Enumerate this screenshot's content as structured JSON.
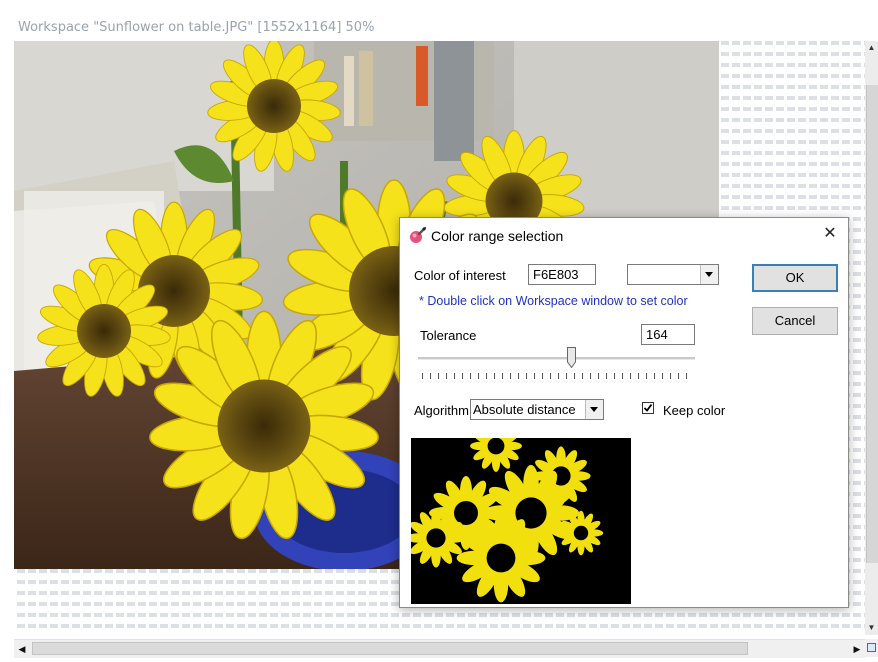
{
  "window": {
    "title": "Workspace \"Sunflower on table.JPG\"  [1552x1164]  50%"
  },
  "dialog": {
    "title": "Color range selection",
    "color_of_interest_label": "Color of interest",
    "color_value": "F6E803",
    "color_dropdown_value": "",
    "hint": "* Double click on Workspace window to set color",
    "tolerance_label": "Tolerance",
    "tolerance_value": "164",
    "tolerance_level": 0.58,
    "algorithm_label": "Algorithm",
    "algorithm_value": "Absolute distance",
    "keep_color_label": "Keep color",
    "keep_color_checked": true,
    "ok_label": "OK",
    "cancel_label": "Cancel"
  },
  "colors": {
    "hint_text": "#1d33c4",
    "default_button_border": "#3c7fb1",
    "selected_color": "#F6E803"
  },
  "icons": [
    "color-picker-icon",
    "close-icon",
    "scroll-up-icon",
    "scroll-down-icon",
    "scroll-left-icon",
    "scroll-right-icon",
    "dropdown-arrow-icon",
    "checkmark-icon"
  ]
}
